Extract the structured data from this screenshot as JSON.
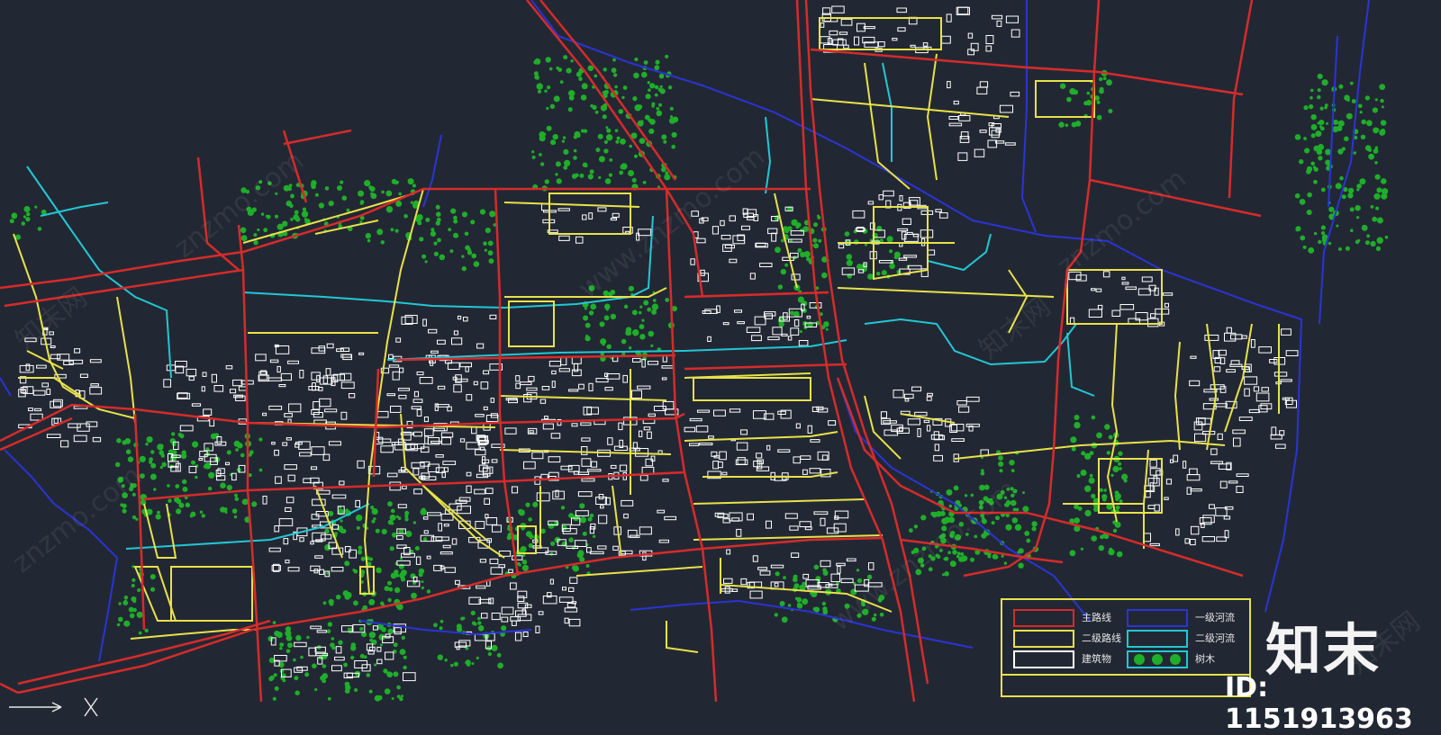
{
  "watermarks": [
    "znzmo.com",
    "知末网",
    "www.znzmo.com"
  ],
  "legend": {
    "items": [
      {
        "label": "主路线",
        "color": "#d62b2b",
        "kind": "line"
      },
      {
        "label": "一级河流",
        "color": "#2b33d6",
        "kind": "line"
      },
      {
        "label": "二级路线",
        "color": "#e8e24a",
        "kind": "line"
      },
      {
        "label": "二级河流",
        "color": "#22c7d4",
        "kind": "line"
      },
      {
        "label": "建筑物",
        "color": "#ffffff",
        "kind": "box"
      },
      {
        "label": "树木",
        "color": "#1fae2a",
        "kind": "tree"
      }
    ]
  },
  "brand": {
    "name": "知末",
    "id": "ID: 1151913963"
  },
  "colors": {
    "background": "#222833",
    "main_road": "#d62b2b",
    "secondary_road": "#e8e24a",
    "primary_river": "#2b33d6",
    "secondary_river": "#22c7d4",
    "building": "#ffffff",
    "tree": "#1fae2a"
  },
  "icons": [
    "ucs-axis-icon",
    "tree-symbol-icon"
  ]
}
